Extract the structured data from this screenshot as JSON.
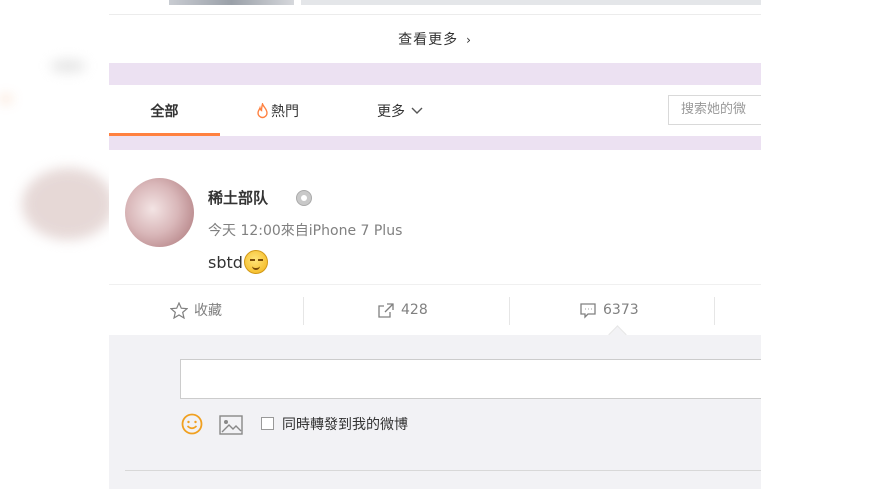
{
  "feed": {
    "more_label": "查看更多",
    "more_chevron": "›"
  },
  "tabs": {
    "all": "全部",
    "hot": "熱門",
    "hot_icon": "fire-icon",
    "more": "更多",
    "more_chevron": "⌄"
  },
  "search": {
    "placeholder": "搜索她的微"
  },
  "post": {
    "username": "稀土部队",
    "meta": "今天 12:00來自iPhone 7 Plus",
    "content": "sbtd",
    "emoji": "emoji-icon"
  },
  "actions": {
    "favorite": "收藏",
    "forward_count": "428",
    "comment_count": "6373"
  },
  "comment": {
    "sync_label": "同時轉發到我的微博",
    "sync_checked": false
  },
  "colors": {
    "accent": "#ff8140",
    "band": "#ece1f2",
    "comment_bg": "#f2f2f5"
  }
}
